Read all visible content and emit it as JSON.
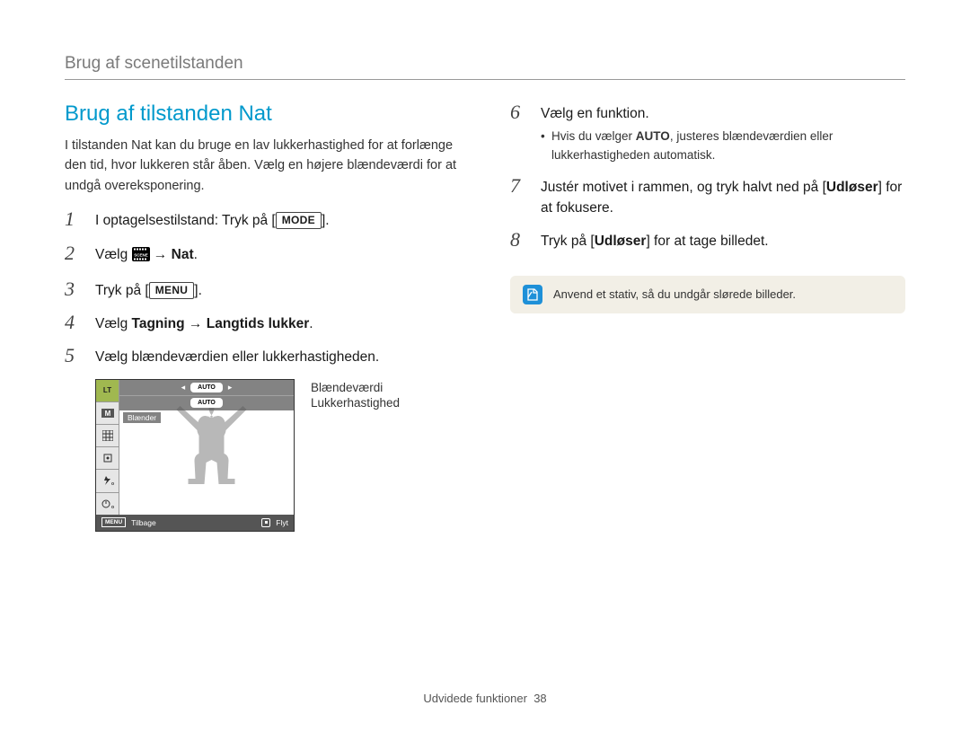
{
  "breadcrumb": "Brug af scenetilstanden",
  "title": "Brug af tilstanden Nat",
  "intro": "I tilstanden Nat kan du bruge en lav lukkerhastighed for at forlænge den tid, hvor lukkeren står åben. Vælg en højere blændeværdi for at undgå overeksponering.",
  "steps_left": {
    "s1_a": "I optagelsestilstand: Tryk på [",
    "s1_key": "MODE",
    "s1_b": "].",
    "s2_a": "Vælg ",
    "s2_b": " → ",
    "s2_bold": "Nat",
    "s2_c": ".",
    "s3_a": "Tryk på [",
    "s3_key": "MENU",
    "s3_b": "].",
    "s4_a": "Vælg ",
    "s4_bold": "Tagning → Langtids lukker",
    "s4_b": ".",
    "s5": "Vælg blændeværdien eller lukkerhastigheden."
  },
  "steps_right": {
    "s6": "Vælg en funktion.",
    "s6_bullet_a": "Hvis du vælger ",
    "s6_bullet_bold": "AUTO",
    "s6_bullet_b": ", justeres blændeværdien eller lukkerhastigheden automatisk.",
    "s7_a": "Justér motivet i rammen, og tryk halvt ned på [",
    "s7_bold": "Udløser",
    "s7_b": "] for at fokusere.",
    "s8_a": "Tryk på [",
    "s8_bold": "Udløser",
    "s8_b": "] for at tage billedet."
  },
  "note": "Anvend et stativ, så du undgår slørede billeder.",
  "lcd": {
    "side_lt": "LT",
    "side_m": "M",
    "auto1": "AUTO",
    "auto2": "AUTO",
    "aperture_label": "Blænder",
    "menu_chip": "MENU",
    "back": "Tilbage",
    "move": "Flyt",
    "label1": "Blændeværdi",
    "label2": "Lukkerhastighed"
  },
  "footer_text": "Udvidede funktioner",
  "footer_page": "38"
}
